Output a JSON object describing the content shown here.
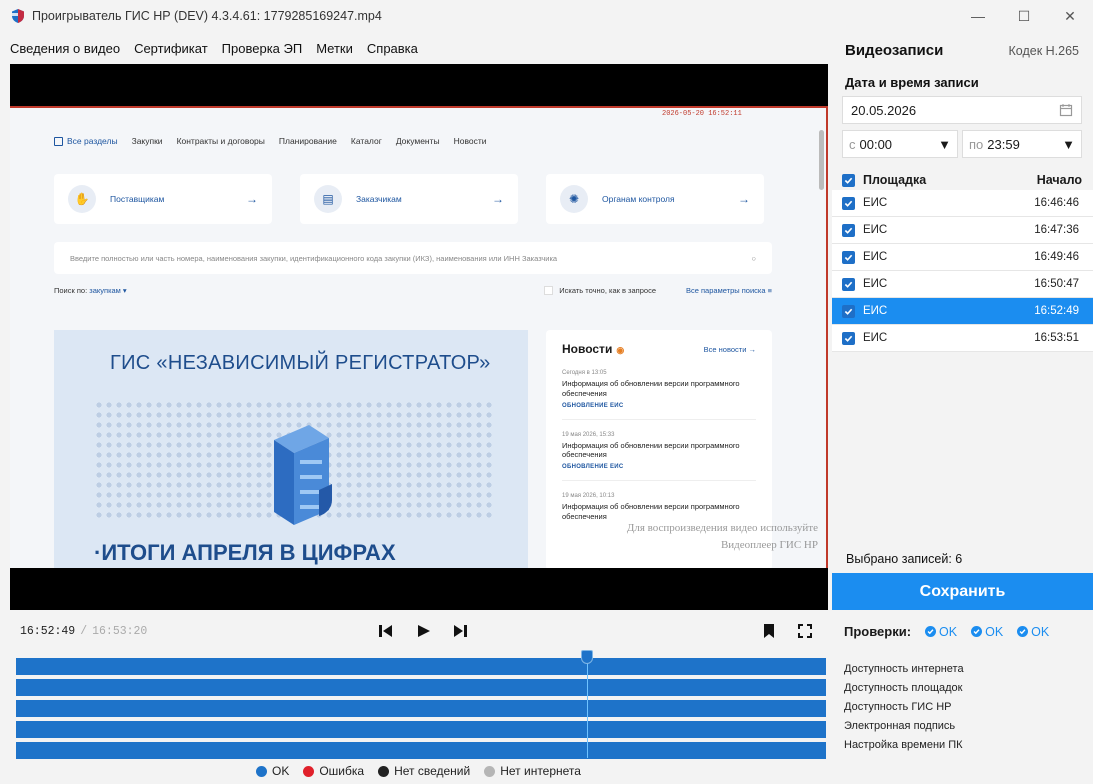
{
  "window": {
    "title": "Проигрыватель ГИС НР (DEV) 4.3.4.61: 1779285169247.mp4",
    "minimize": "—",
    "maximize": "☐",
    "close": "✕"
  },
  "menu": [
    "Сведения о видео",
    "Сертификат",
    "Проверка ЭП",
    "Метки",
    "Справка"
  ],
  "video": {
    "rec_time": "2026-05-20 16:52:11",
    "site_nav": [
      "Все разделы",
      "Закупки",
      "Контракты и договоры",
      "Планирование",
      "Каталог",
      "Документы",
      "Новости"
    ],
    "cards": [
      {
        "label": "Поставщикам",
        "icon": "handshake-icon"
      },
      {
        "label": "Заказчикам",
        "icon": "document-icon"
      },
      {
        "label": "Органам контроля",
        "icon": "emblem-icon"
      }
    ],
    "search_placeholder": "Введите полностью или часть номера, наименования закупки, идентификационного кода закупки (ИКЗ), наименования или ИНН Заказчика",
    "search_by_label": "Поиск по:",
    "search_by_value": "закупкам ▾",
    "exact_label": "Искать точно, как в запросе",
    "all_params": "Все параметры поиска",
    "banner_title": "ГИС «НЕЗАВИСИМЫЙ РЕГИСТРАТОР»",
    "banner_bottom": "·ИТОГИ АПРЕЛЯ В ЦИФРАХ",
    "news_title": "Новости",
    "news_all": "Все новости",
    "news": [
      {
        "date": "Сегодня в 13:05",
        "text": "Информация об обновлении версии программного обеспечения",
        "tag": "ОБНОВЛЕНИЕ ЕИС"
      },
      {
        "date": "19 мая 2026, 15:33",
        "text": "Информация об обновлении версии программного обеспечения",
        "tag": "ОБНОВЛЕНИЕ ЕИС"
      },
      {
        "date": "19 мая 2026, 10:13",
        "text": "Информация об обновлении версии программного обеспечения",
        "tag": ""
      }
    ],
    "watermark_line1": "Для воспроизведения видео используйте",
    "watermark_line2": "Видеоплеер ГИС НР"
  },
  "player": {
    "current_time": "16:52:49",
    "separator": "/",
    "total_time": "16:53:20",
    "cursor_fraction": 0.705
  },
  "legend": [
    {
      "label": "OK",
      "color": "#1e73c9"
    },
    {
      "label": "Ошибка",
      "color": "#e0202a"
    },
    {
      "label": "Нет сведений",
      "color": "#222222"
    },
    {
      "label": "Нет интернета",
      "color": "#b5b5b5"
    }
  ],
  "panel": {
    "title": "Видеозаписи",
    "codec": "Кодек H.265",
    "date_label": "Дата и время записи",
    "date_value": "20.05.2026",
    "from_prefix": "с",
    "from_value": "00:00",
    "to_prefix": "по",
    "to_value": "23:59",
    "col_source": "Площадка",
    "col_start": "Начало",
    "rows": [
      {
        "source": "ЕИС",
        "start": "16:46:46"
      },
      {
        "source": "ЕИС",
        "start": "16:47:36"
      },
      {
        "source": "ЕИС",
        "start": "16:49:46"
      },
      {
        "source": "ЕИС",
        "start": "16:50:47"
      },
      {
        "source": "ЕИС",
        "start": "16:52:49"
      },
      {
        "source": "ЕИС",
        "start": "16:53:51"
      }
    ],
    "selected_row": 4,
    "selected_count": "Выбрано записей: 6",
    "save": "Сохранить"
  },
  "checks": {
    "label": "Проверки:",
    "statuses": [
      "OK",
      "OK",
      "OK"
    ],
    "items": [
      "Доступность интернета",
      "Доступность площадок",
      "Доступность ГИС НР",
      "Электронная подпись",
      "Настройка времени ПК"
    ]
  }
}
